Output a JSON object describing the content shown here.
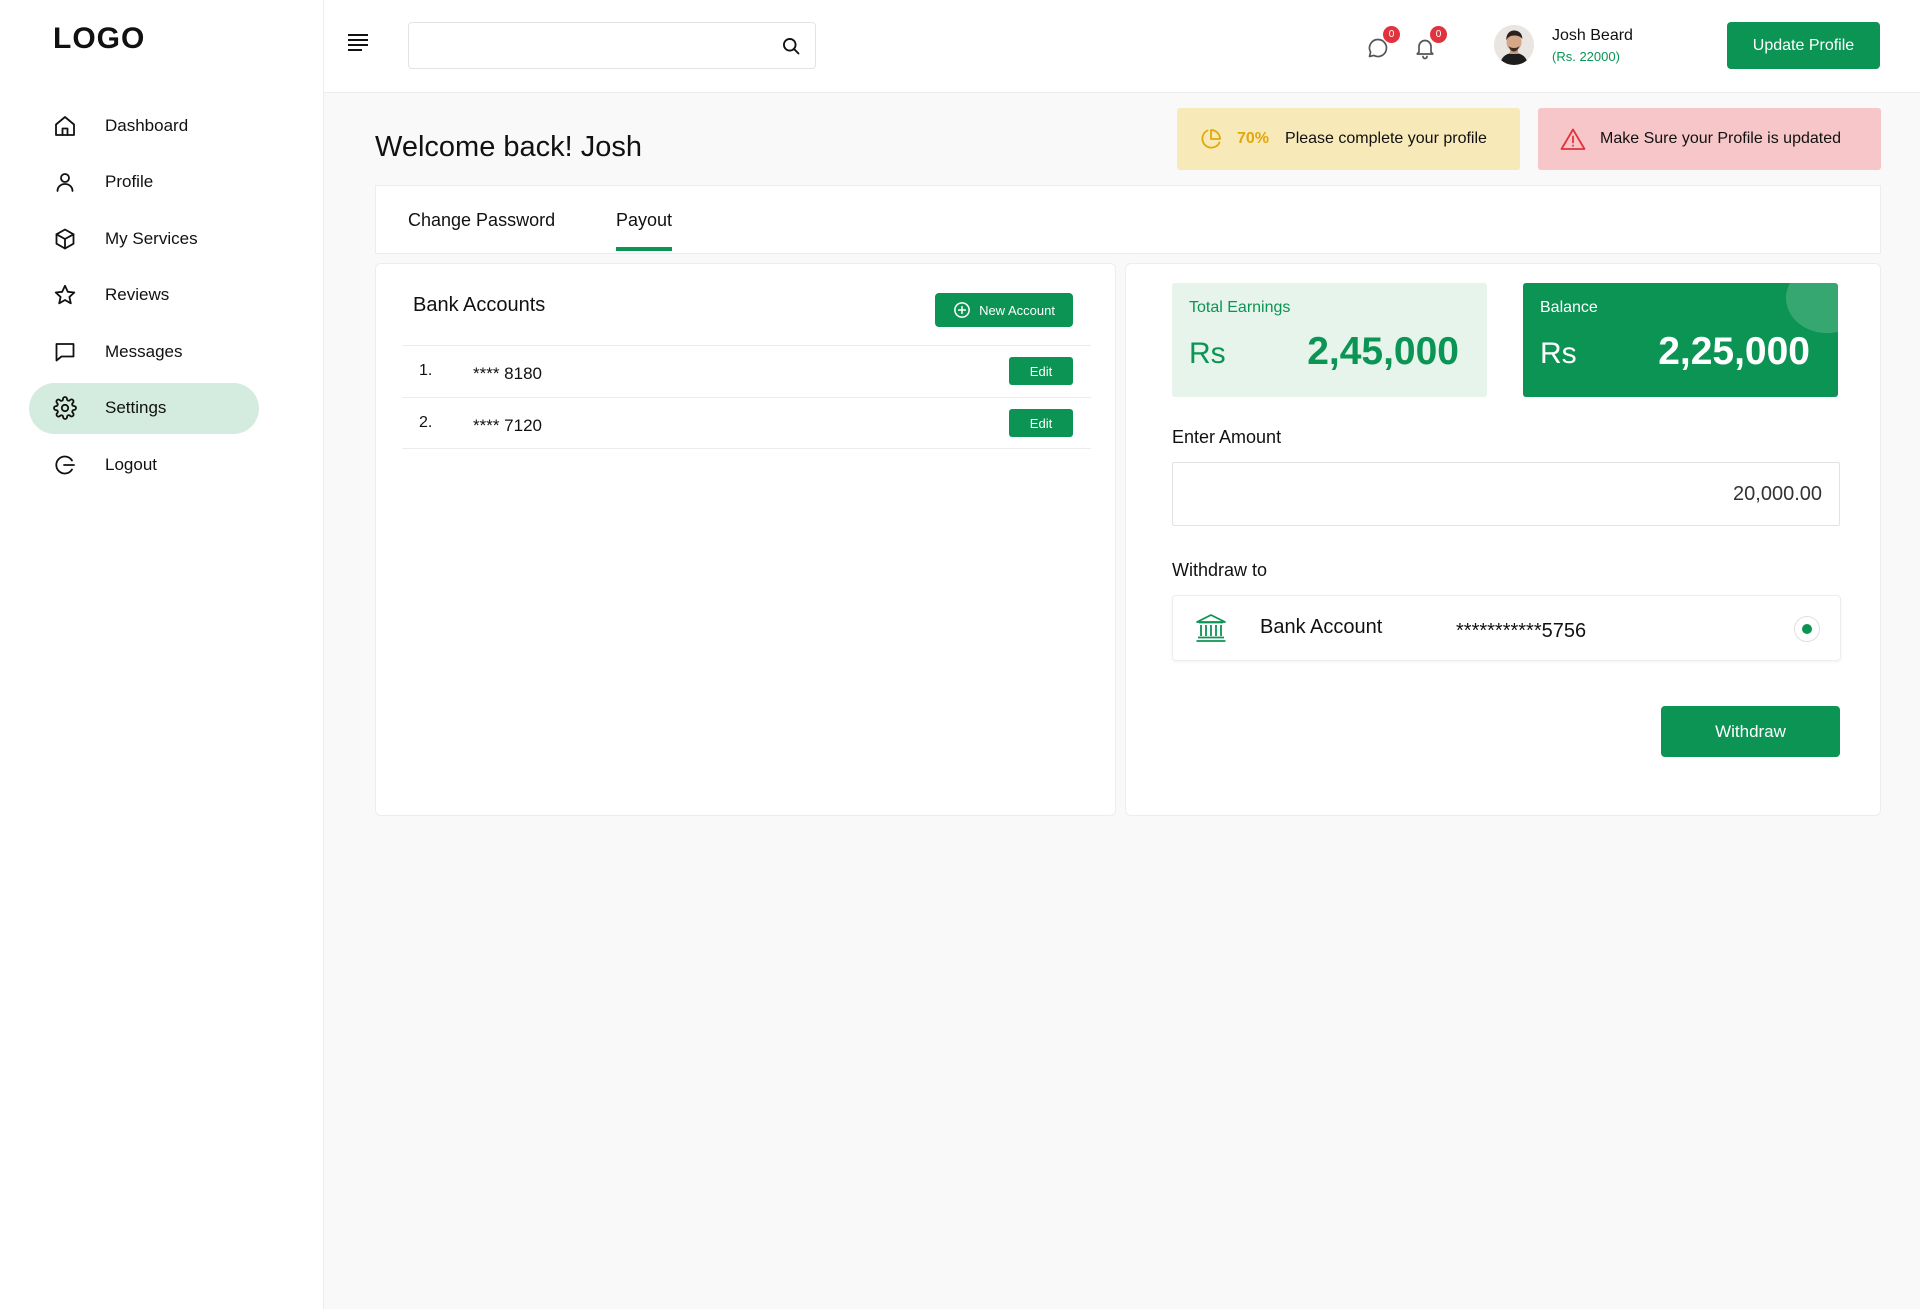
{
  "sidebar": {
    "logo": "LOGO",
    "items": [
      {
        "label": "Dashboard",
        "icon": "home-icon"
      },
      {
        "label": "Profile",
        "icon": "user-icon"
      },
      {
        "label": "My Services",
        "icon": "box-icon"
      },
      {
        "label": "Reviews",
        "icon": "star-icon"
      },
      {
        "label": "Messages",
        "icon": "message-icon"
      },
      {
        "label": "Settings",
        "icon": "gear-icon",
        "active": true
      },
      {
        "label": "Logout",
        "icon": "logout-icon"
      }
    ]
  },
  "topbar": {
    "search": {
      "placeholder": "",
      "value": ""
    },
    "messages_badge": "0",
    "notifications_badge": "0",
    "user": {
      "name": "Josh Beard",
      "balance": "(Rs. 22000)"
    },
    "update_profile_label": "Update Profile"
  },
  "main": {
    "welcome": "Welcome back! Josh",
    "notices": {
      "progress_percent": "70%",
      "progress_message": "Please complete your profile",
      "alert_message": "Make Sure your Profile is updated"
    },
    "tabs": [
      {
        "label": "Change Password",
        "active": false
      },
      {
        "label": "Payout",
        "active": true
      }
    ],
    "bank_accounts": {
      "title": "Bank Accounts",
      "new_account_label": "New Account",
      "rows": [
        {
          "index": "1.",
          "masked": "**** 8180",
          "edit_label": "Edit"
        },
        {
          "index": "2.",
          "masked": "**** 7120",
          "edit_label": "Edit"
        }
      ]
    },
    "payout": {
      "total_earnings": {
        "label": "Total Earnings",
        "currency": "Rs",
        "amount": "2,45,000"
      },
      "balance": {
        "label": "Balance",
        "currency": "Rs",
        "amount": "2,25,000"
      },
      "enter_amount_label": "Enter Amount",
      "amount_value": "20,000.00",
      "withdraw_to_label": "Withdraw to",
      "withdraw_option": {
        "label": "Bank Account",
        "masked": "***********5756",
        "selected": true
      },
      "withdraw_label": "Withdraw"
    }
  },
  "colors": {
    "accent": "#0b9454",
    "active_nav_bg": "#d4ecdf",
    "progress_notice_bg": "#f8e9b8",
    "alert_notice_bg": "#f7c6c8",
    "badge": "#e0333d"
  }
}
